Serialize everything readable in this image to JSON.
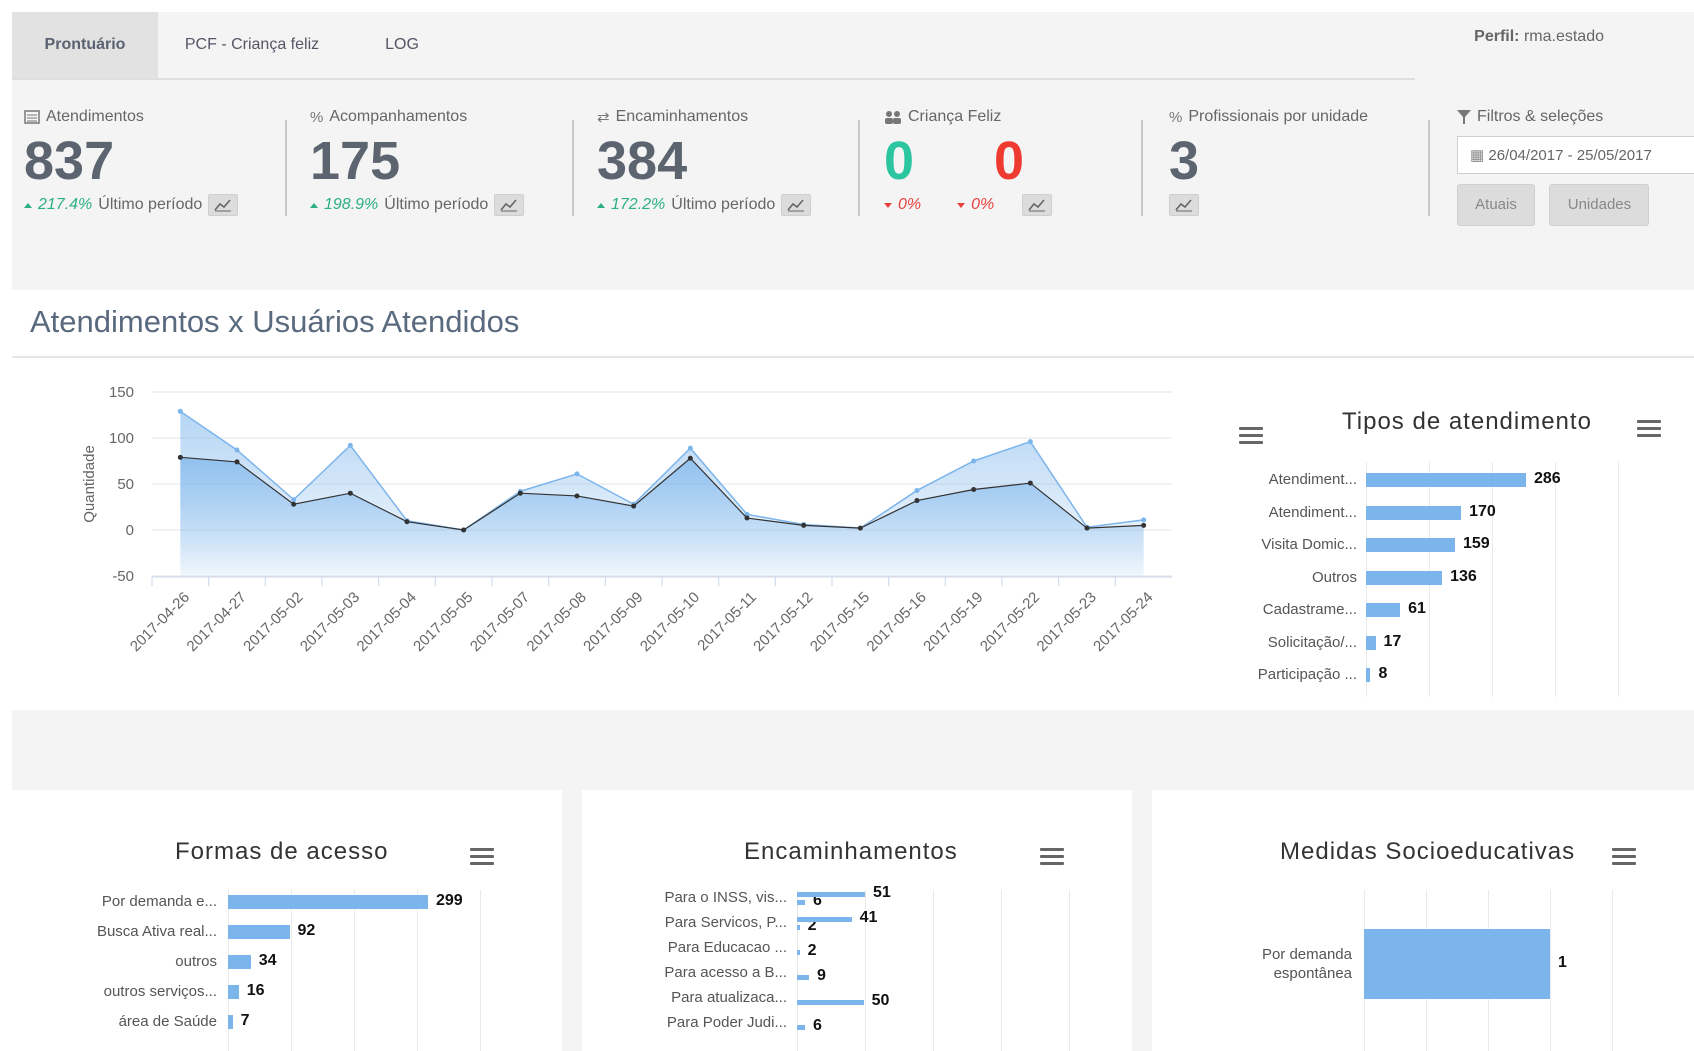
{
  "tabs": [
    {
      "label": "Prontuário",
      "active": true
    },
    {
      "label": "PCF - Criança feliz",
      "active": false
    },
    {
      "label": "LOG",
      "active": false
    }
  ],
  "profile": {
    "label": "Perfil:",
    "value": "rma.estado"
  },
  "kpis": {
    "atendimentos": {
      "label": "Atendimentos",
      "value": "837",
      "pct": "217.4%",
      "period": "Último período"
    },
    "acompanhamentos": {
      "label": "Acompanhamentos",
      "value": "175",
      "pct": "198.9%",
      "period": "Último período"
    },
    "encaminhamentos": {
      "label": "Encaminhamentos",
      "value": "384",
      "pct": "172.2%",
      "period": "Último período"
    },
    "crianca_feliz": {
      "label": "Criança Feliz",
      "value_a": "0",
      "value_b": "0",
      "pct_a": "0%",
      "pct_b": "0%"
    },
    "profissionais": {
      "label": "Profissionais por unidade",
      "value": "3"
    }
  },
  "filters": {
    "label": "Filtros & seleções",
    "date_range": "26/04/2017 - 25/05/2017",
    "btn_atuais": "Atuais",
    "btn_unidades": "Unidades"
  },
  "section_title": "Atendimentos x Usuários Atendidos",
  "colors": {
    "bar": "#7cb5ec",
    "area": "#7cb5ec",
    "line": "#333333",
    "up": "#2bb07f",
    "down": "#e8413d",
    "kpi_green": "#2bc5a0",
    "kpi_red": "#ee3a2f"
  },
  "chart_data": [
    {
      "type": "area",
      "ylabel": "Quantidade",
      "ylim": [
        -50,
        150
      ],
      "yticks": [
        "150",
        "100",
        "50",
        "0",
        "-50"
      ],
      "categories": [
        "2017-04-26",
        "2017-04-27",
        "2017-05-02",
        "2017-05-03",
        "2017-05-04",
        "2017-05-05",
        "2017-05-07",
        "2017-05-08",
        "2017-05-09",
        "2017-05-10",
        "2017-05-11",
        "2017-05-12",
        "2017-05-15",
        "2017-05-16",
        "2017-05-19",
        "2017-05-22",
        "2017-05-23",
        "2017-05-24"
      ],
      "series": [
        {
          "values": [
            129,
            87,
            33,
            92,
            10,
            0,
            42,
            61,
            28,
            89,
            17,
            6,
            2,
            43,
            75,
            96,
            3,
            11
          ]
        },
        {
          "values": [
            79,
            74,
            28,
            40,
            9,
            0,
            40,
            37,
            26,
            78,
            13,
            5,
            2,
            32,
            44,
            51,
            2,
            5
          ]
        }
      ]
    },
    {
      "type": "bar",
      "title": "Tipos de atendimento",
      "categories": [
        "Atendiment...",
        "Atendiment...",
        "Visita Domic...",
        "Outros",
        "Cadastrame...",
        "Solicitação/...",
        "Participação ..."
      ],
      "values": [
        286,
        170,
        159,
        136,
        61,
        17,
        8
      ]
    },
    {
      "type": "bar",
      "title": "Formas de acesso",
      "categories": [
        "Por demanda e...",
        "Busca Ativa real...",
        "outros",
        "outros serviços...",
        "área de Saúde"
      ],
      "values": [
        299,
        92,
        34,
        16,
        7
      ]
    },
    {
      "type": "bar",
      "title": "Encaminhamentos",
      "categories": [
        "Para o INSS, vis...",
        "Para Servicos, P...",
        "Para Educacao ...",
        "Para acesso a B...",
        "Para atualizaca...",
        "Para Poder Judi..."
      ],
      "series": [
        {
          "values": [
            6,
            2,
            2,
            9,
            50,
            6
          ]
        },
        {
          "values": [
            51,
            41,
            null,
            null,
            null,
            null
          ]
        }
      ]
    },
    {
      "type": "bar",
      "title": "Medidas Socioeducativas",
      "categories": [
        "Por demanda espontânea"
      ],
      "values": [
        1
      ]
    }
  ]
}
